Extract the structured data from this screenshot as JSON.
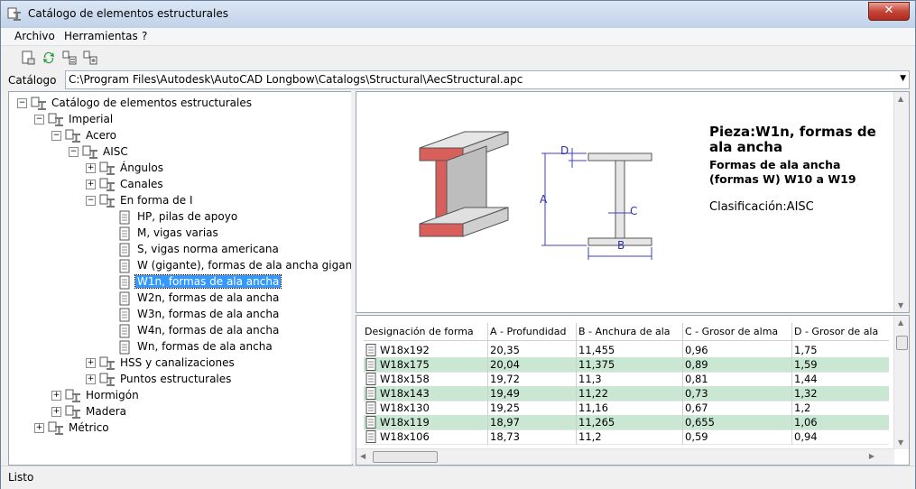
{
  "window": {
    "title": "Catálogo de elementos estructurales",
    "close_glyph": "✕"
  },
  "menu": [
    "Archivo",
    "Herramientas",
    "?"
  ],
  "toolbar": [
    "new-catalog-icon",
    "refresh-icon",
    "catalog-tree-icon",
    "catalog-settings-icon"
  ],
  "catalog": {
    "label": "Catálogo",
    "path": "C:\\Program Files\\Autodesk\\AutoCAD Longbow\\Catalogs\\Structural\\AecStructural.apc"
  },
  "tree": [
    "Catálogo de elementos estructurales",
    "Imperial",
    "Acero",
    "AISC",
    "Ángulos",
    "Canales",
    "En forma de I",
    "HP, pilas de apoyo",
    "M, vigas varias",
    "S, vigas norma americana",
    "W (gigante), formas de ala ancha gigantes",
    "W1n, formas de ala ancha",
    "W2n, formas de ala ancha",
    "W3n, formas de ala ancha",
    "W4n, formas de ala ancha",
    "Wn, formas de ala ancha",
    "HSS y canalizaciones",
    "Puntos estructurales",
    "Hormigón",
    "Madera",
    "Métrico"
  ],
  "preview": {
    "title": "Pieza:W1n, formas de ala ancha",
    "subtitle": "Formas de ala ancha (formas W) W10 a W19",
    "classification": "Clasificación:AISC",
    "dims": {
      "a": "A",
      "b": "B",
      "c": "C",
      "d": "D"
    }
  },
  "table": {
    "headers": [
      "Designación de forma",
      "A - Profundidad",
      "B - Anchura de ala",
      "C - Grosor de alma",
      "D - Grosor de ala"
    ],
    "rows": [
      [
        "W18x192",
        "20,35",
        "11,455",
        "0,96",
        "1,75"
      ],
      [
        "W18x175",
        "20,04",
        "11,375",
        "0,89",
        "1,59"
      ],
      [
        "W18x158",
        "19,72",
        "11,3",
        "0,81",
        "1,44"
      ],
      [
        "W18x143",
        "19,49",
        "11,22",
        "0,73",
        "1,32"
      ],
      [
        "W18x130",
        "19,25",
        "11,16",
        "0,67",
        "1,2"
      ],
      [
        "W18x119",
        "18,97",
        "11,265",
        "0,655",
        "1,06"
      ],
      [
        "W18x106",
        "18,73",
        "11,2",
        "0,59",
        "0,94"
      ]
    ]
  },
  "status": "Listo",
  "colors": {
    "selection": "#3399ff",
    "alt_row": "#c9e7d3",
    "flange_red": "#d9605a"
  }
}
